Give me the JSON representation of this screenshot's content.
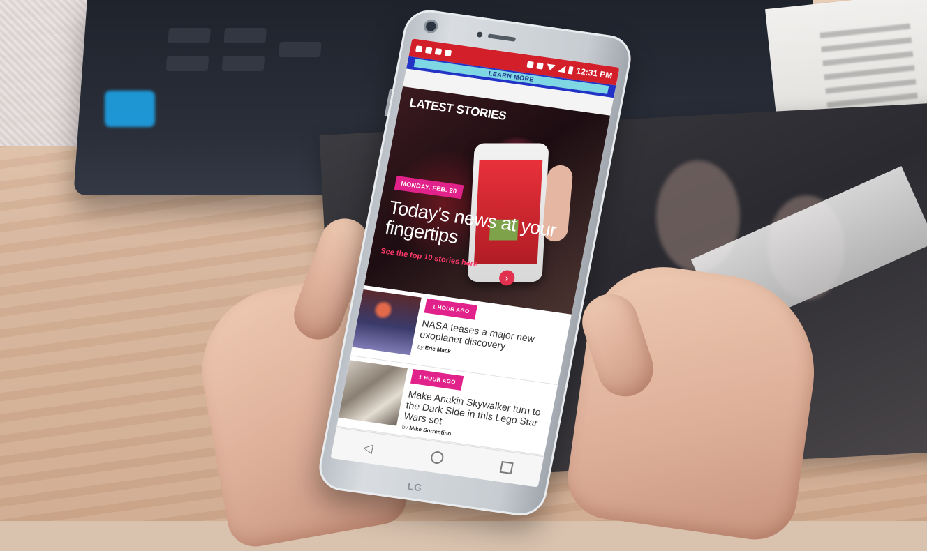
{
  "status_bar": {
    "time": "12:31 PM",
    "left_icons": [
      "message-icon",
      "app-icon",
      "app-icon",
      "app-icon"
    ],
    "right_icons": [
      "headset-icon",
      "nfc-icon",
      "wifi-icon",
      "signal-icon",
      "battery-icon"
    ],
    "color": "#d21f2a"
  },
  "banner": {
    "label": "LEARN MORE"
  },
  "hero": {
    "section_title": "LATEST STORIES",
    "date_badge": "MONDAY, FEB. 20",
    "headline": "Today's news at your fingertips",
    "cta": "See the top 10 stories here",
    "cta_icon": "chevron-right-icon",
    "accent": "#e0228a"
  },
  "stories": [
    {
      "badge": "1 HOUR AGO",
      "title": "NASA teases a major new exoplanet discovery",
      "byline_prefix": "by",
      "author": "Eric Mack"
    },
    {
      "badge": "1 HOUR AGO",
      "title": "Make Anakin Skywalker turn to the Dark Side in this Lego Star Wars set",
      "byline_prefix": "by",
      "author": "Mike Sorrentino"
    }
  ],
  "navbar": {
    "back_icon": "◁",
    "home_icon": "circle-home-icon",
    "recents_icon": "square-recents-icon"
  },
  "device": {
    "brand": "LG"
  }
}
